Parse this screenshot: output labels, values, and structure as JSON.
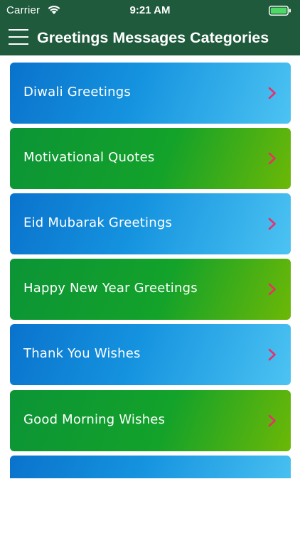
{
  "status_bar": {
    "carrier": "Carrier",
    "time": "9:21 AM",
    "wifi_icon": "wifi-icon",
    "battery_icon": "battery-icon"
  },
  "nav": {
    "menu_icon": "hamburger-menu-icon",
    "title": "Greetings Messages Categories"
  },
  "colors": {
    "header": "#1f5a3c",
    "card_blue": "#1593df",
    "card_green": "#13a22a",
    "chevron": "#e8306a"
  },
  "categories": [
    {
      "label": "Diwali Greetings",
      "style": "blue"
    },
    {
      "label": "Motivational Quotes",
      "style": "green"
    },
    {
      "label": "Eid Mubarak Greetings",
      "style": "blue"
    },
    {
      "label": "Happy New Year Greetings",
      "style": "green"
    },
    {
      "label": "Thank You Wishes",
      "style": "blue"
    },
    {
      "label": "Good Morning Wishes",
      "style": "green"
    },
    {
      "label": "",
      "style": "blue"
    }
  ]
}
